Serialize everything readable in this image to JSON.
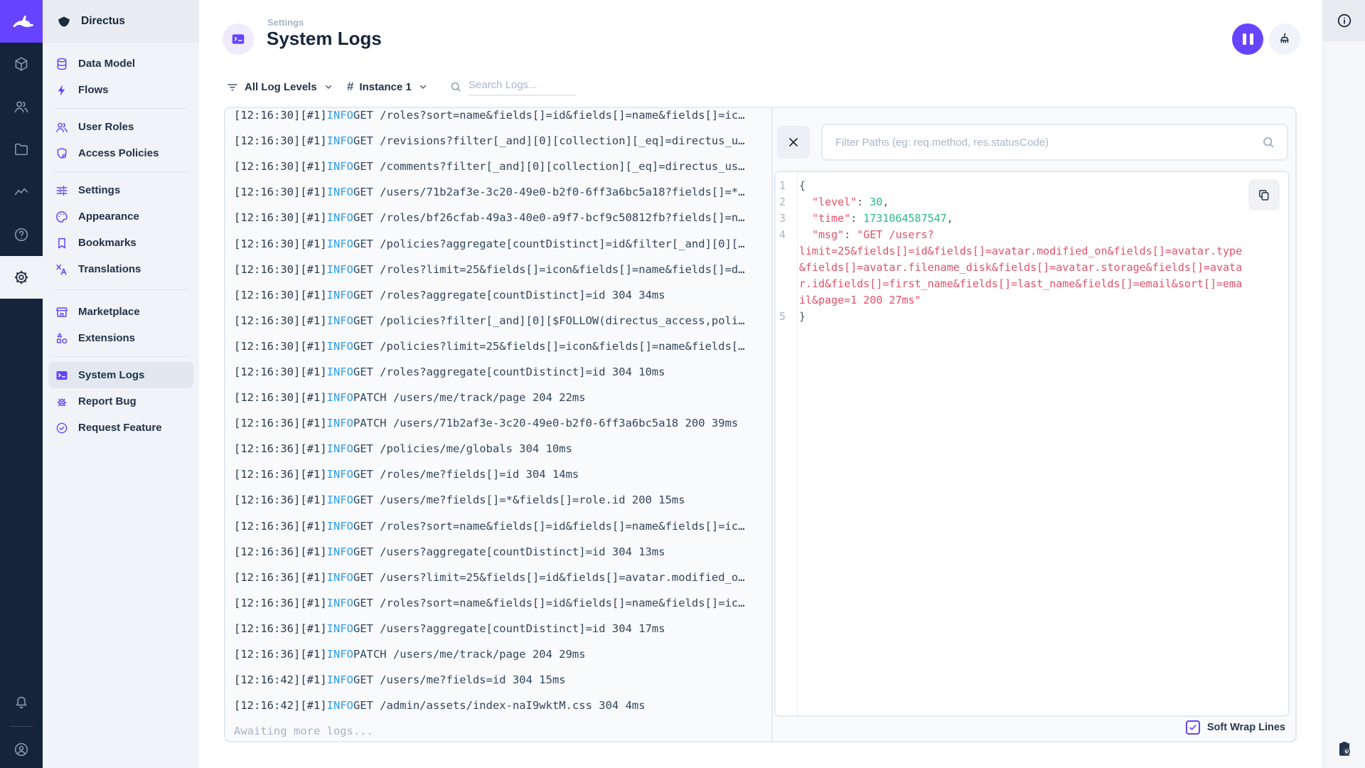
{
  "sidebar": {
    "project_name": "Directus",
    "sections": [
      {
        "items": [
          {
            "label": "Data Model",
            "icon": "database-icon"
          },
          {
            "label": "Flows",
            "icon": "bolt-icon"
          }
        ]
      },
      {
        "items": [
          {
            "label": "User Roles",
            "icon": "user-roles-icon"
          },
          {
            "label": "Access Policies",
            "icon": "shield-badge-icon"
          }
        ]
      },
      {
        "items": [
          {
            "label": "Settings",
            "icon": "tune-icon"
          },
          {
            "label": "Appearance",
            "icon": "palette-icon"
          },
          {
            "label": "Bookmarks",
            "icon": "bookmark-icon"
          },
          {
            "label": "Translations",
            "icon": "translate-icon"
          }
        ]
      },
      {
        "items": [
          {
            "label": "Marketplace",
            "icon": "storefront-icon"
          },
          {
            "label": "Extensions",
            "icon": "extensions-icon"
          }
        ]
      },
      {
        "items": [
          {
            "label": "System Logs",
            "icon": "terminal-icon",
            "active": true
          },
          {
            "label": "Report Bug",
            "icon": "bug-icon"
          },
          {
            "label": "Request Feature",
            "icon": "feature-icon"
          }
        ]
      }
    ]
  },
  "module_bar": {
    "modules": [
      "box-icon",
      "users-icon",
      "folder-icon",
      "activity-icon",
      "help-icon",
      "settings-gear-icon"
    ],
    "active_module": "settings-gear-icon",
    "bottom": [
      "bell-icon",
      "avatar-icon"
    ]
  },
  "header": {
    "breadcrumb": "Settings",
    "title": "System Logs",
    "buttons": [
      "pause-logs-button",
      "clear-logs-button"
    ]
  },
  "toolbar": {
    "level_filter": "All Log Levels",
    "hash_symbol": "#",
    "instance_filter": "Instance 1",
    "search_placeholder": "Search Logs..."
  },
  "logs": {
    "footer": "Awaiting more logs...",
    "entries": [
      {
        "time": "12:16:30",
        "pid": "#1",
        "level": "INFO",
        "message": "GET /roles?sort=name&fields[]=id&fields[]=name&fields[]=ic…"
      },
      {
        "time": "12:16:30",
        "pid": "#1",
        "level": "INFO",
        "message": "GET /revisions?filter[_and][0][collection][_eq]=directus_u…"
      },
      {
        "time": "12:16:30",
        "pid": "#1",
        "level": "INFO",
        "message": "GET /comments?filter[_and][0][collection][_eq]=directus_us…"
      },
      {
        "time": "12:16:30",
        "pid": "#1",
        "level": "INFO",
        "message": "GET /users/71b2af3e-3c20-49e0-b2f0-6ff3a6bc5a18?fields[]=*…"
      },
      {
        "time": "12:16:30",
        "pid": "#1",
        "level": "INFO",
        "message": "GET /roles/bf26cfab-49a3-40e0-a9f7-bcf9c50812fb?fields[]=n…"
      },
      {
        "time": "12:16:30",
        "pid": "#1",
        "level": "INFO",
        "message": "GET /policies?aggregate[countDistinct]=id&filter[_and][0][…"
      },
      {
        "time": "12:16:30",
        "pid": "#1",
        "level": "INFO",
        "message": "GET /roles?limit=25&fields[]=icon&fields[]=name&fields[]=d…"
      },
      {
        "time": "12:16:30",
        "pid": "#1",
        "level": "INFO",
        "message": "GET /roles?aggregate[countDistinct]=id 304 34ms"
      },
      {
        "time": "12:16:30",
        "pid": "#1",
        "level": "INFO",
        "message": "GET /policies?filter[_and][0][$FOLLOW(directus_access,poli…"
      },
      {
        "time": "12:16:30",
        "pid": "#1",
        "level": "INFO",
        "message": "GET /policies?limit=25&fields[]=icon&fields[]=name&fields[…"
      },
      {
        "time": "12:16:30",
        "pid": "#1",
        "level": "INFO",
        "message": "GET /roles?aggregate[countDistinct]=id 304 10ms"
      },
      {
        "time": "12:16:30",
        "pid": "#1",
        "level": "INFO",
        "message": "PATCH /users/me/track/page 204 22ms"
      },
      {
        "time": "12:16:36",
        "pid": "#1",
        "level": "INFO",
        "message": "PATCH /users/71b2af3e-3c20-49e0-b2f0-6ff3a6bc5a18 200 39ms"
      },
      {
        "time": "12:16:36",
        "pid": "#1",
        "level": "INFO",
        "message": "GET /policies/me/globals 304 10ms"
      },
      {
        "time": "12:16:36",
        "pid": "#1",
        "level": "INFO",
        "message": "GET /roles/me?fields[]=id 304 14ms"
      },
      {
        "time": "12:16:36",
        "pid": "#1",
        "level": "INFO",
        "message": "GET /users/me?fields[]=*&fields[]=role.id 200 15ms"
      },
      {
        "time": "12:16:36",
        "pid": "#1",
        "level": "INFO",
        "message": "GET /roles?sort=name&fields[]=id&fields[]=name&fields[]=ic…"
      },
      {
        "time": "12:16:36",
        "pid": "#1",
        "level": "INFO",
        "message": "GET /users?aggregate[countDistinct]=id 304 13ms"
      },
      {
        "time": "12:16:36",
        "pid": "#1",
        "level": "INFO",
        "message": "GET /users?limit=25&fields[]=id&fields[]=avatar.modified_o…"
      },
      {
        "time": "12:16:36",
        "pid": "#1",
        "level": "INFO",
        "message": "GET /roles?sort=name&fields[]=id&fields[]=name&fields[]=ic…"
      },
      {
        "time": "12:16:36",
        "pid": "#1",
        "level": "INFO",
        "message": "GET /users?aggregate[countDistinct]=id 304 17ms"
      },
      {
        "time": "12:16:36",
        "pid": "#1",
        "level": "INFO",
        "message": "PATCH /users/me/track/page 204 29ms"
      },
      {
        "time": "12:16:42",
        "pid": "#1",
        "level": "INFO",
        "message": "GET /users/me?fields=id 304 15ms"
      },
      {
        "time": "12:16:42",
        "pid": "#1",
        "level": "INFO",
        "message": "GET /admin/assets/index-naI9wktM.css 304 4ms"
      }
    ]
  },
  "detail": {
    "filter_placeholder": "Filter Paths (eg: req.method, res.statusCode)",
    "soft_wrap_label": "Soft Wrap Lines",
    "soft_wrap_checked": true,
    "code_lines": [
      {
        "num": "1",
        "segments": [
          {
            "type": "punct",
            "text": "{"
          }
        ]
      },
      {
        "num": "2",
        "segments": [
          {
            "type": "punct",
            "text": "  "
          },
          {
            "type": "key",
            "text": "\"level\""
          },
          {
            "type": "punct",
            "text": ": "
          },
          {
            "type": "number",
            "text": "30"
          },
          {
            "type": "punct",
            "text": ","
          }
        ]
      },
      {
        "num": "3",
        "segments": [
          {
            "type": "punct",
            "text": "  "
          },
          {
            "type": "key",
            "text": "\"time\""
          },
          {
            "type": "punct",
            "text": ": "
          },
          {
            "type": "number",
            "text": "1731064587547"
          },
          {
            "type": "punct",
            "text": ","
          }
        ]
      },
      {
        "num": "4",
        "segments": [
          {
            "type": "punct",
            "text": "  "
          },
          {
            "type": "key",
            "text": "\"msg\""
          },
          {
            "type": "punct",
            "text": ": "
          },
          {
            "type": "string",
            "text": "\"GET /users?limit=25&fields[]=id&fields[]=avatar.modified_on&fields[]=avatar.type&fields[]=avatar.filename_disk&fields[]=avatar.storage&fields[]=avatar.id&fields[]=first_name&fields[]=last_name&fields[]=email&sort[]=email&page=1 200 27ms\""
          }
        ]
      },
      {
        "num": "5",
        "segments": [
          {
            "type": "punct",
            "text": "}"
          }
        ]
      }
    ]
  },
  "icons": {
    "pause-icon": "two vertical bars",
    "broom-icon": "clear/sweep glyph",
    "search-icon": "magnifier",
    "filter-icon": "funnel lines",
    "chevron-down-icon": "v",
    "close-icon": "x",
    "copy-icon": "duplicate sheets",
    "info-icon": "circled i",
    "clipboard-clock-icon": "paste with clock",
    "bell-icon": "notifications",
    "avatar-icon": "user circle"
  },
  "colors": {
    "accent": "#6644FF",
    "module_bar_bg": "#15233B",
    "nav_bg": "#F0F3F7",
    "panel_border": "#E5EAF1",
    "info_level": "#2F9CF1",
    "json_key": "#E35169",
    "json_number": "#2BB98A"
  }
}
